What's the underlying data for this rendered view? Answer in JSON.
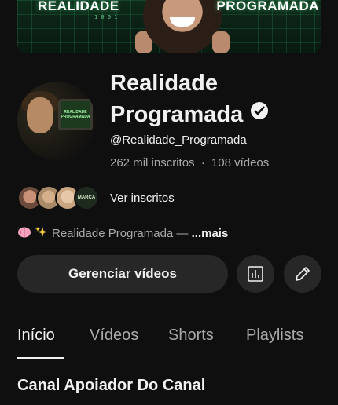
{
  "banner": {
    "left_text": "REALIDADE",
    "right_text": "PROGRAMADA",
    "bits": "1 0 0 1"
  },
  "channel": {
    "name_line1": "Realidade",
    "name_line2": "Programada",
    "handle": "@Realidade_Programada",
    "subscribers": "262 mil inscritos",
    "separator": "·",
    "videos": "108 vídeos",
    "avatar_monitor_text": "REALIDADE PROGRAMADA"
  },
  "subscribers_row": {
    "label": "Ver inscritos",
    "avatar4_text": "MARCA"
  },
  "description": {
    "text": "Realidade Programada — ",
    "more": "...mais"
  },
  "actions": {
    "manage_label": "Gerenciar vídeos",
    "analytics_icon": "analytics-icon",
    "edit_icon": "pencil-icon"
  },
  "tabs": [
    {
      "label": "Início",
      "active": true
    },
    {
      "label": "Vídeos",
      "active": false
    },
    {
      "label": "Shorts",
      "active": false
    },
    {
      "label": "Playlists",
      "active": false
    }
  ],
  "section": {
    "title": "Canal Apoiador Do Canal"
  },
  "colors": {
    "background": "#0f0f0f",
    "button": "#272727",
    "text": "#f1f1f1",
    "muted": "#aaaaaa"
  }
}
